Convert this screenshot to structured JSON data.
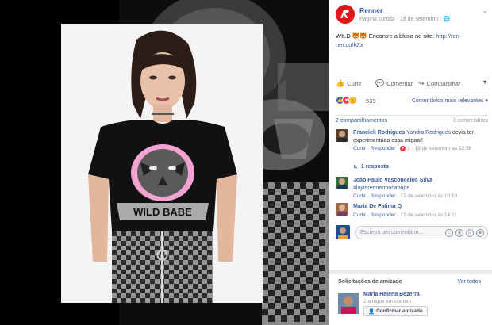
{
  "post": {
    "page_name": "Renner",
    "meta_label": "Página curtida",
    "date": "18 de setembro",
    "text": "WILD 🐯🐯 Encontre a blusa no site:",
    "link": "http://ren-ner.co/kZx"
  },
  "shirt": {
    "print_text": "WILD BABE"
  },
  "actions": {
    "like": "Curtir",
    "comment": "Comentar",
    "share": "Compartilhar"
  },
  "reactions": {
    "count": "539",
    "sort_label": "Comentários mais relevantes"
  },
  "stats": {
    "shares": "2 compartilhamentos",
    "comments": "3 comentários"
  },
  "comments": [
    {
      "name": "Francieli Rodrigues",
      "tag": "Yandra Rodrigues",
      "text": "devia ter experimentado essa migaa!!",
      "like": "Curtir",
      "reply": "Responder",
      "reaction_count": "1",
      "time": "18 de setembro às 12:58"
    },
    {
      "name": "João Paulo Vasconcelos Silva",
      "tag": "#lojasrennermocabope",
      "text": "",
      "like": "Curtir",
      "reply": "Responder",
      "time": "17 de setembro às 10:19"
    },
    {
      "name": "Maria De Fatima Q",
      "tag": "",
      "text": "",
      "like": "Curtir",
      "reply": "Responder",
      "time": "17 de setembro às 14:11"
    }
  ],
  "replies_link": "1 resposta",
  "write_comment": {
    "placeholder": "Escreva um comentário..."
  },
  "friend_requests": {
    "heading": "Solicitações de amizade",
    "see_all": "Ver todos",
    "name": "Maria Helena Bezerra",
    "mutual": "2 amigos em comum",
    "confirm": "Confirmar amizade"
  },
  "colors": {
    "link": "#365899",
    "muted": "#90949c",
    "like_blue": "#4267b2",
    "love_red": "#f33e58",
    "wow_yellow": "#f7b125",
    "brand_red": "#e3151b",
    "tiger_pink": "#f2a3d2"
  }
}
